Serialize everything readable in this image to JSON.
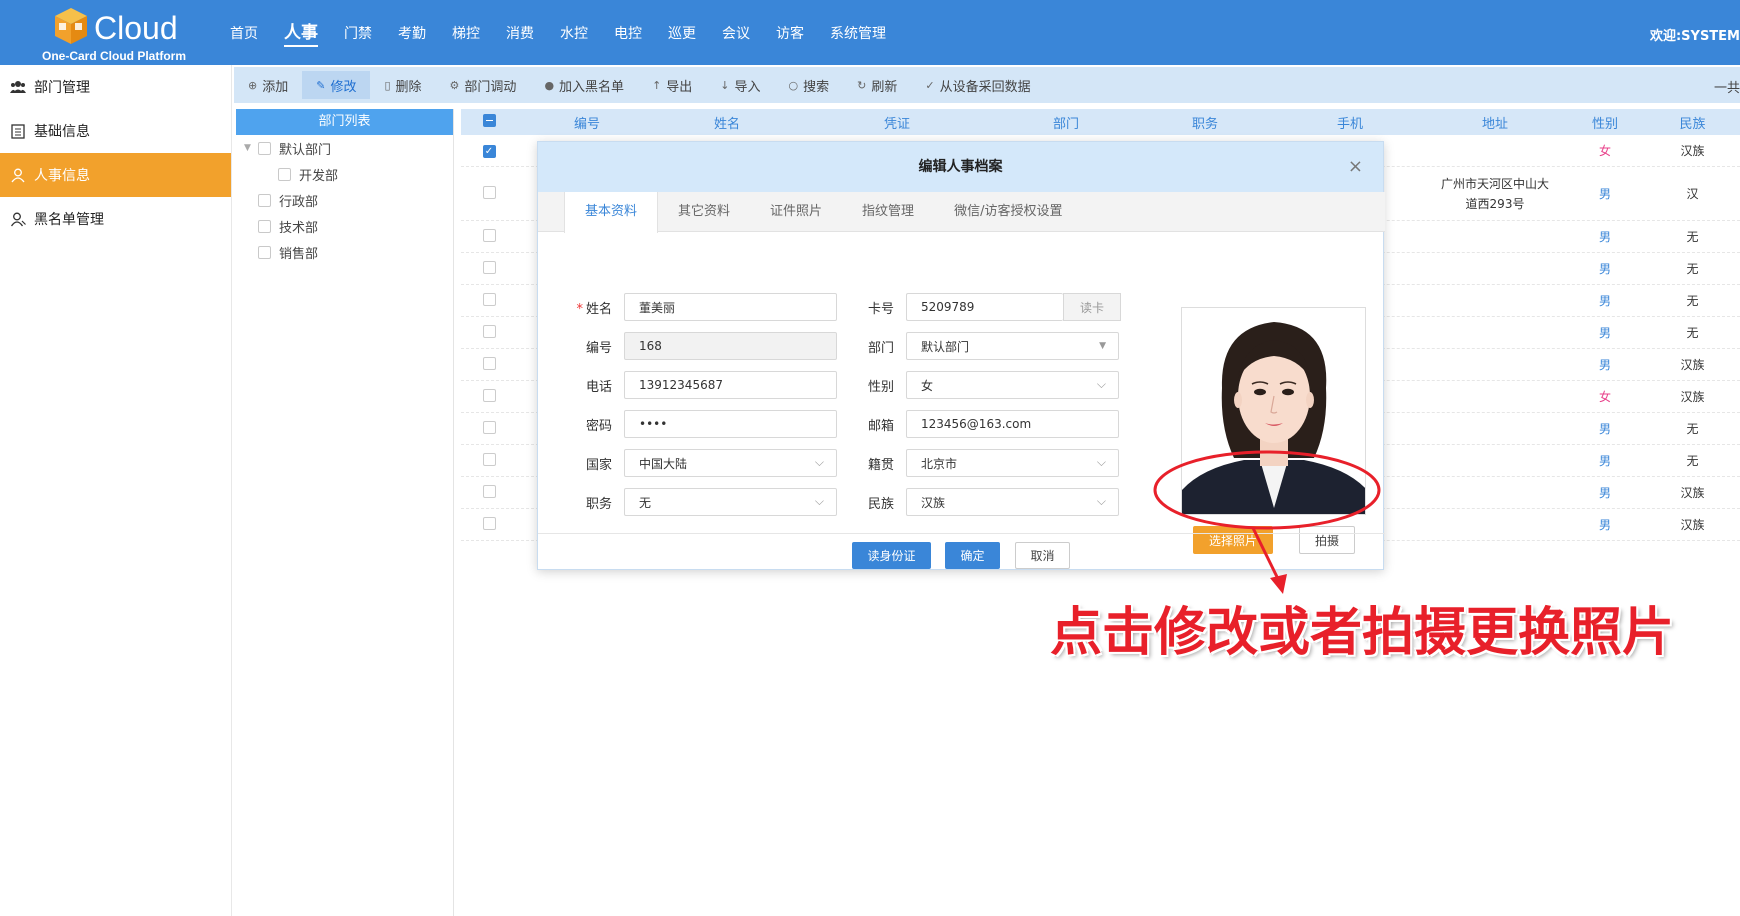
{
  "header": {
    "logo_text": "Cloud",
    "logo_subtitle": "One-Card Cloud Platform",
    "nav": [
      "首页",
      "人事",
      "门禁",
      "考勤",
      "梯控",
      "消费",
      "水控",
      "电控",
      "巡更",
      "会议",
      "访客",
      "系统管理"
    ],
    "active_nav": "人事",
    "welcome": "欢迎:SYSTEM"
  },
  "sidebar": {
    "items": [
      {
        "label": "部门管理",
        "icon": "group-icon"
      },
      {
        "label": "基础信息",
        "icon": "list-icon"
      },
      {
        "label": "人事信息",
        "icon": "user-icon",
        "active": true
      },
      {
        "label": "黑名单管理",
        "icon": "user-block-icon"
      }
    ]
  },
  "toolbar": {
    "buttons": [
      {
        "label": "添加",
        "icon": "⊕"
      },
      {
        "label": "修改",
        "icon": "✎",
        "active": true
      },
      {
        "label": "删除",
        "icon": "🗑"
      },
      {
        "label": "部门调动",
        "icon": "⚙"
      },
      {
        "label": "加入黑名单",
        "icon": "●"
      },
      {
        "label": "导出",
        "icon": "↑"
      },
      {
        "label": "导入",
        "icon": "↓"
      },
      {
        "label": "搜索",
        "icon": "○"
      },
      {
        "label": "刷新",
        "icon": "↻"
      },
      {
        "label": "从设备采回数据",
        "icon": "✓"
      }
    ],
    "total_text": "一共"
  },
  "dept_tree": {
    "title": "部门列表",
    "items": [
      {
        "label": "默认部门",
        "level": 0,
        "expandable": true
      },
      {
        "label": "开发部",
        "level": 1
      },
      {
        "label": "行政部",
        "level": 0
      },
      {
        "label": "技术部",
        "level": 0
      },
      {
        "label": "销售部",
        "level": 0
      }
    ]
  },
  "table": {
    "columns": [
      "编号",
      "姓名",
      "凭证",
      "部门",
      "职务",
      "手机",
      "地址",
      "性别",
      "民族"
    ],
    "rows": [
      {
        "address": "",
        "gender": "女",
        "ethnic": "汉族",
        "checked": true
      },
      {
        "address": "广州市天河区中山大道西293号",
        "gender": "男",
        "ethnic": "汉",
        "checked": false
      },
      {
        "address": "",
        "gender": "男",
        "ethnic": "无",
        "checked": false
      },
      {
        "address": "",
        "gender": "男",
        "ethnic": "无",
        "checked": false
      },
      {
        "address": "",
        "gender": "男",
        "ethnic": "无",
        "checked": false
      },
      {
        "address": "",
        "gender": "男",
        "ethnic": "无",
        "checked": false
      },
      {
        "address": "",
        "gender": "男",
        "ethnic": "汉族",
        "checked": false
      },
      {
        "address": "",
        "gender": "女",
        "ethnic": "汉族",
        "checked": false
      },
      {
        "address": "",
        "gender": "男",
        "ethnic": "无",
        "checked": false
      },
      {
        "address": "",
        "gender": "男",
        "ethnic": "无",
        "checked": false
      },
      {
        "address": "",
        "gender": "男",
        "ethnic": "汉族",
        "checked": false
      },
      {
        "address": "",
        "gender": "男",
        "ethnic": "汉族",
        "checked": false
      }
    ]
  },
  "modal": {
    "title": "编辑人事档案",
    "close": "×",
    "tabs": [
      "基本资料",
      "其它资料",
      "证件照片",
      "指纹管理",
      "微信/访客授权设置"
    ],
    "active_tab": "基本资料",
    "left_fields": [
      {
        "label": "姓名",
        "value": "董美丽",
        "required": true
      },
      {
        "label": "编号",
        "value": "168",
        "disabled": true
      },
      {
        "label": "电话",
        "value": "13912345687"
      },
      {
        "label": "密码",
        "value": "••••"
      },
      {
        "label": "国家",
        "value": "中国大陆",
        "select": true
      },
      {
        "label": "职务",
        "value": "无",
        "select": true
      }
    ],
    "right_fields": [
      {
        "label": "卡号",
        "value": "5209789",
        "button": "读卡"
      },
      {
        "label": "部门",
        "value": "默认部门",
        "select": true
      },
      {
        "label": "性别",
        "value": "女",
        "select": true
      },
      {
        "label": "邮箱",
        "value": "123456@163.com"
      },
      {
        "label": "籍贯",
        "value": "北京市",
        "select": true
      },
      {
        "label": "民族",
        "value": "汉族",
        "select": true
      }
    ],
    "choose_photo": "选择照片",
    "take_photo": "拍摄",
    "footer": {
      "read_id": "读身份证",
      "confirm": "确定",
      "cancel": "取消"
    }
  },
  "annotation": {
    "text": "点击修改或者拍摄更换照片",
    "color": "#e8202a"
  }
}
